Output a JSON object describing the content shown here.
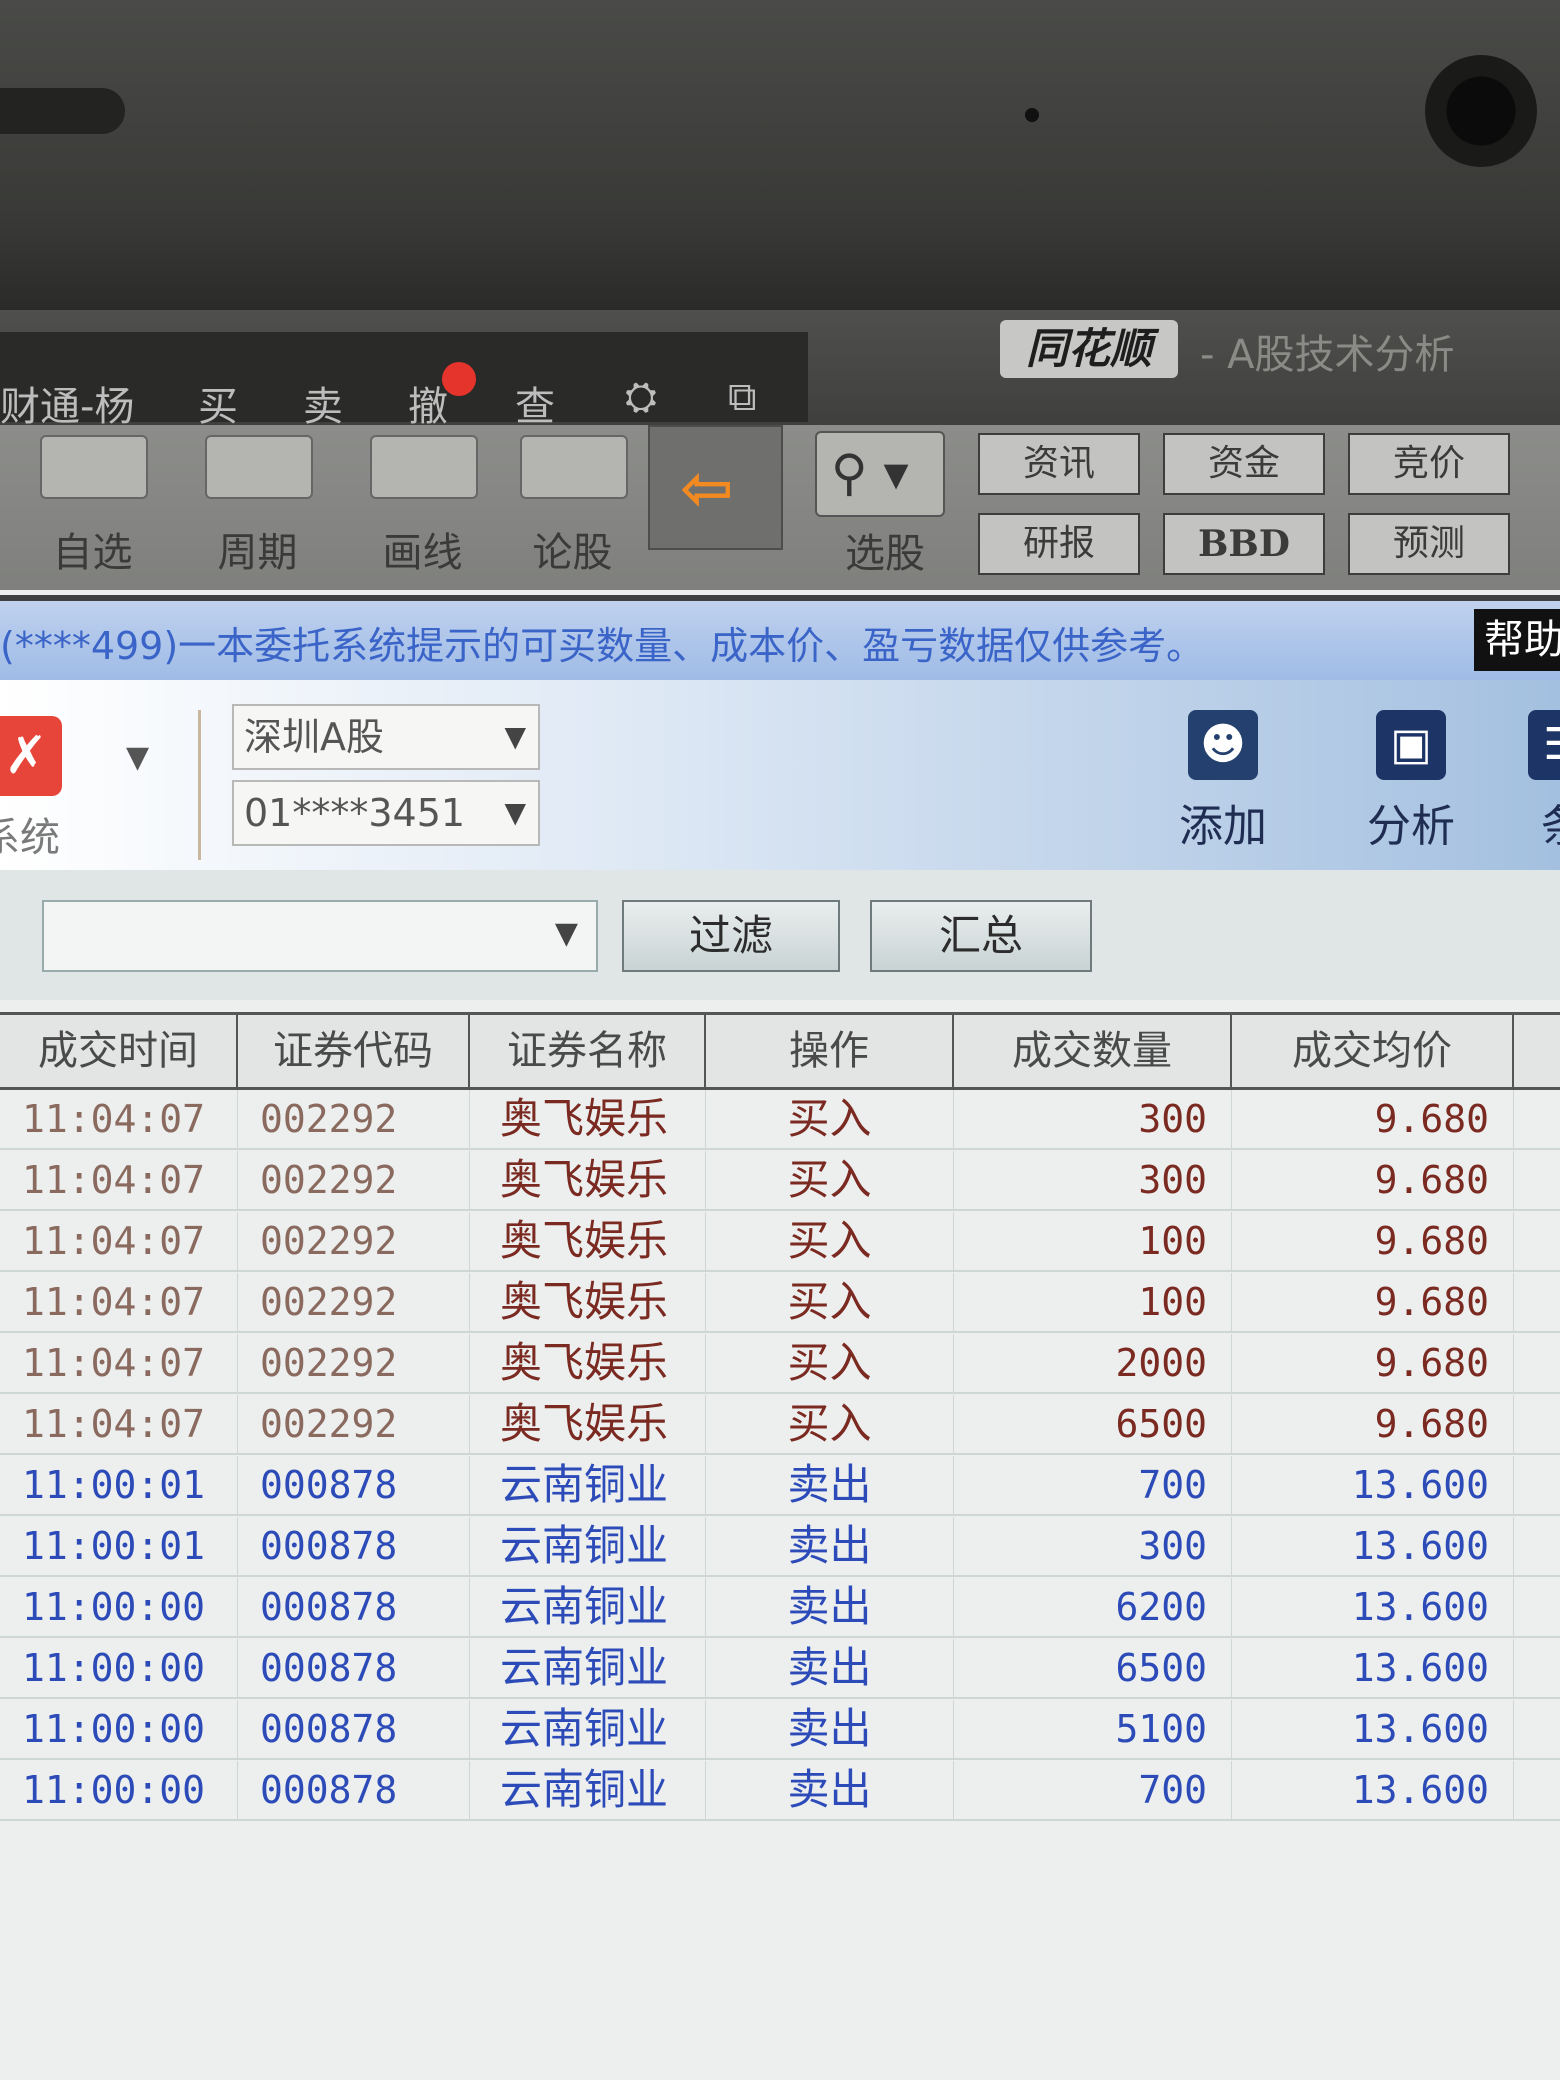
{
  "topbar": {
    "menu": [
      "财通-杨",
      "买",
      "卖",
      "撤",
      "查",
      "⛭",
      "⧉"
    ],
    "logo": "同花顺",
    "subtitle": "- A股技术分析"
  },
  "toolbar": {
    "tools": [
      "自选",
      "周期",
      "画线",
      "论股"
    ],
    "screener_label": "选股",
    "quick_buttons": [
      "资讯",
      "资金",
      "竞价",
      "研报",
      "BBD",
      "预测"
    ]
  },
  "ticker": {
    "text": "(****499)一本委托系统提示的可买数量、成本价、盈亏数据仅供参考。",
    "help_label": "帮助"
  },
  "account": {
    "system_label": "系统",
    "market": "深圳A股",
    "account_no": "01****3451",
    "actions": [
      "添加",
      "分析",
      "条"
    ]
  },
  "filter": {
    "combo_value": "",
    "filter_button": "过滤",
    "summary_button": "汇总"
  },
  "colors": {
    "buy": "#7b2a22",
    "sell": "#2c4bb8"
  },
  "table": {
    "headers": [
      "成交时间",
      "证券代码",
      "证券名称",
      "操作",
      "成交数量",
      "成交均价"
    ],
    "rows": [
      {
        "time": "11:04:07",
        "code": "002292",
        "name": "奥飞娱乐",
        "op": "买入",
        "qty": "300",
        "price": "9.680",
        "side": "buy"
      },
      {
        "time": "11:04:07",
        "code": "002292",
        "name": "奥飞娱乐",
        "op": "买入",
        "qty": "300",
        "price": "9.680",
        "side": "buy"
      },
      {
        "time": "11:04:07",
        "code": "002292",
        "name": "奥飞娱乐",
        "op": "买入",
        "qty": "100",
        "price": "9.680",
        "side": "buy"
      },
      {
        "time": "11:04:07",
        "code": "002292",
        "name": "奥飞娱乐",
        "op": "买入",
        "qty": "100",
        "price": "9.680",
        "side": "buy"
      },
      {
        "time": "11:04:07",
        "code": "002292",
        "name": "奥飞娱乐",
        "op": "买入",
        "qty": "2000",
        "price": "9.680",
        "side": "buy"
      },
      {
        "time": "11:04:07",
        "code": "002292",
        "name": "奥飞娱乐",
        "op": "买入",
        "qty": "6500",
        "price": "9.680",
        "side": "buy"
      },
      {
        "time": "11:00:01",
        "code": "000878",
        "name": "云南铜业",
        "op": "卖出",
        "qty": "700",
        "price": "13.600",
        "side": "sell"
      },
      {
        "time": "11:00:01",
        "code": "000878",
        "name": "云南铜业",
        "op": "卖出",
        "qty": "300",
        "price": "13.600",
        "side": "sell"
      },
      {
        "time": "11:00:00",
        "code": "000878",
        "name": "云南铜业",
        "op": "卖出",
        "qty": "6200",
        "price": "13.600",
        "side": "sell"
      },
      {
        "time": "11:00:00",
        "code": "000878",
        "name": "云南铜业",
        "op": "卖出",
        "qty": "6500",
        "price": "13.600",
        "side": "sell"
      },
      {
        "time": "11:00:00",
        "code": "000878",
        "name": "云南铜业",
        "op": "卖出",
        "qty": "5100",
        "price": "13.600",
        "side": "sell"
      },
      {
        "time": "11:00:00",
        "code": "000878",
        "name": "云南铜业",
        "op": "卖出",
        "qty": "700",
        "price": "13.600",
        "side": "sell"
      }
    ]
  }
}
